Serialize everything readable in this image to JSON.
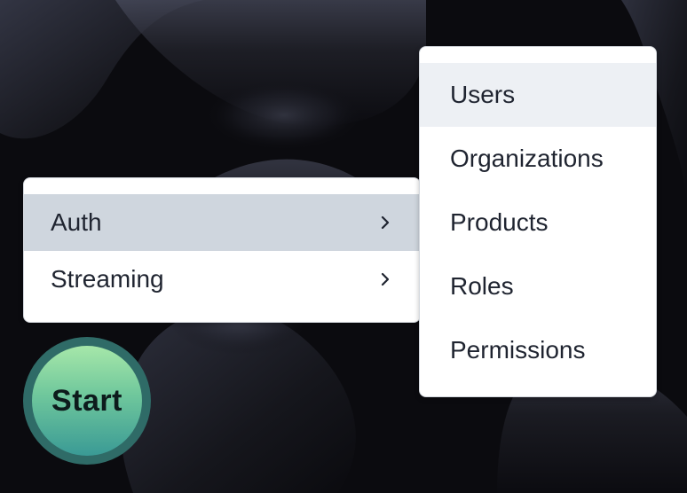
{
  "primary_menu": {
    "items": [
      {
        "label": "Auth",
        "has_submenu": true,
        "state": "active"
      },
      {
        "label": "Streaming",
        "has_submenu": true,
        "state": "default"
      }
    ]
  },
  "submenu": {
    "parent": "Auth",
    "items": [
      {
        "label": "Users",
        "state": "hover"
      },
      {
        "label": "Organizations",
        "state": "default"
      },
      {
        "label": "Products",
        "state": "default"
      },
      {
        "label": "Roles",
        "state": "default"
      },
      {
        "label": "Permissions",
        "state": "default"
      }
    ]
  },
  "start_button": {
    "label": "Start"
  },
  "icons": {
    "submenu_indicator": "chevron-right-icon"
  },
  "colors": {
    "desktop_background": "#0b0b0f",
    "menu_background": "#ffffff",
    "active_item": "#cfd6de",
    "hover_item": "#edf0f4",
    "menu_text": "#1f2430",
    "start_ring": "#2f6b67",
    "start_gradient_top": "#a6e7a9",
    "start_gradient_bottom": "#3a9a95"
  }
}
